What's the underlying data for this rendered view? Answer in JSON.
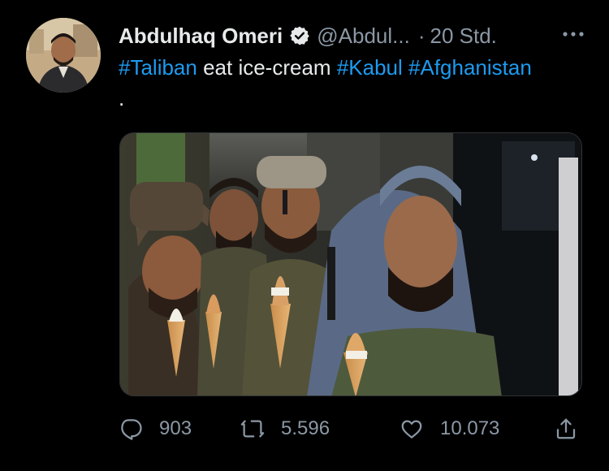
{
  "tweet": {
    "display_name": "Abdulhaq Omeri",
    "handle": "@Abdul...",
    "separator": "·",
    "time": "20 Std.",
    "text_parts": {
      "tag1": "#Taliban",
      "plain1": " eat ice-cream ",
      "tag2": "#Kabul",
      "space": " ",
      "tag3": "#Afghanistan"
    },
    "text_line2": ".",
    "media_description_icon": "photo",
    "colors": {
      "background": "#000000",
      "text": "#e7e9ea",
      "muted": "#8b98a5",
      "link": "#1d9bf0",
      "verified_badge": "#e7e9ea"
    }
  },
  "actions": {
    "reply_count": "903",
    "retweet_count": "5.596",
    "like_count": "10.073",
    "icons": [
      "reply-icon",
      "retweet-icon",
      "like-icon",
      "share-icon"
    ]
  }
}
